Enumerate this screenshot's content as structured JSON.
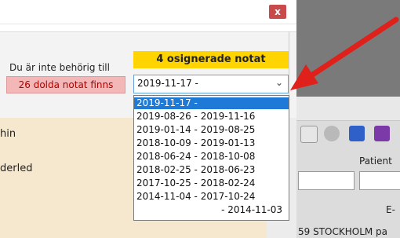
{
  "dialog": {
    "close_label": "x",
    "not_authorized_label": "Du är inte behörig till",
    "hidden_notes": "26 dolda notat finns",
    "unsigned_banner": "4 osignerade notat",
    "select_value": "2019-11-17 -",
    "dropdown_items": [
      "2019-11-17 -",
      "2019-08-26 - 2019-11-16",
      "2019-01-14 - 2019-08-25",
      "2018-10-09 - 2019-01-13",
      "2018-06-24 - 2018-10-08",
      "2018-02-25 - 2018-06-23",
      "2017-10-25 - 2018-02-24",
      "2014-11-04 - 2017-10-24",
      "- 2014-11-03"
    ],
    "side_text_1": "hin",
    "side_text_2": "derled"
  },
  "right_window": {
    "patient_label": "Patient",
    "column_header": "E-",
    "address": "59 STOCKHOLM  pa"
  },
  "colors": {
    "arrow": "#e0201a",
    "banner": "#ffd400",
    "hidden_notes_bg": "#f3b7b7",
    "selected_item": "#1e7ad6"
  }
}
